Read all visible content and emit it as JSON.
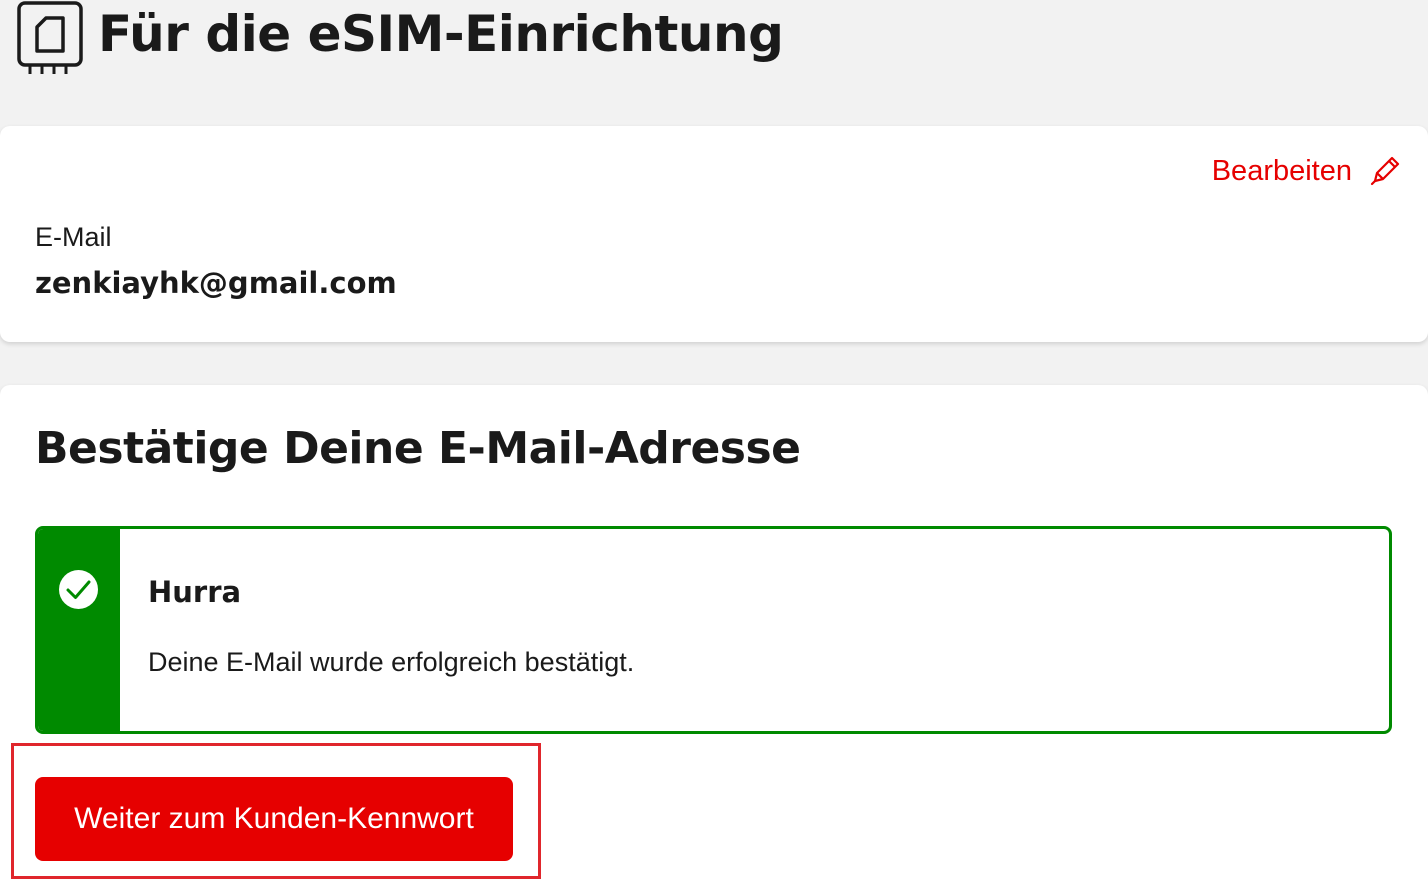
{
  "header": {
    "title": "Für die eSIM-Einrichtung",
    "icon": "sim-card-icon"
  },
  "email_card": {
    "edit_label": "Bearbeiten",
    "edit_icon": "pencil-icon",
    "email_label": "E-Mail",
    "email_value": "zenkiayhk@gmail.com"
  },
  "confirm_card": {
    "title": "Bestätige Deine E-Mail-Adresse",
    "alert": {
      "status": "success",
      "icon": "check-circle-icon",
      "heading": "Hurra",
      "message": "Deine E-Mail wurde erfolgreich bestätigt."
    },
    "continue_label": "Weiter zum Kunden-Kennwort"
  },
  "colors": {
    "brand_red": "#e60000",
    "success_green": "#008a00",
    "background": "#f2f2f2",
    "highlight": "#e0262c"
  }
}
